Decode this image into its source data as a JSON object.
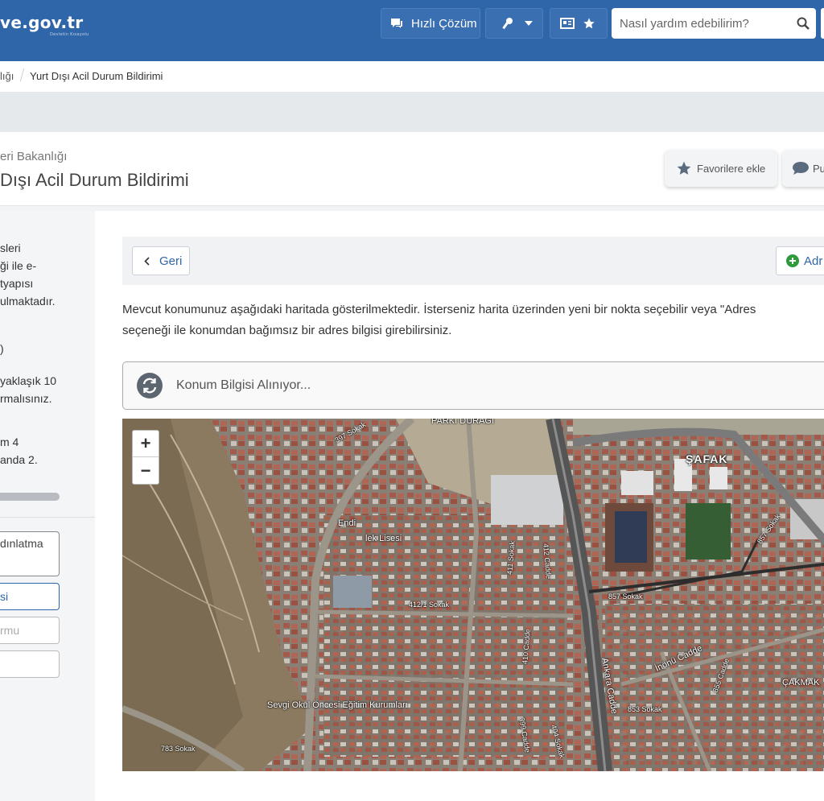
{
  "header": {
    "logo_text": "ve.gov.tr",
    "logo_tagline": "Devletin Kısayolu",
    "quick_solution_label": "Hızlı Çözüm",
    "search_placeholder": "Nasıl yardım edebilirim?",
    "colors": {
      "bar": "#2f66a9",
      "button": "#3a70b2"
    }
  },
  "breadcrumb": {
    "items": [
      "lığı",
      "Yurt Dışı Acil Durum Bildirimi"
    ]
  },
  "title_card": {
    "ministry": "eri Bakanlığı",
    "title": "Dışı Acil Durum Bildirimi",
    "favorite_label": "Favorilere ekle",
    "rate_label": "Pu"
  },
  "sidebar": {
    "p1": [
      "sleri",
      "ği ile e-",
      "tyapısı",
      "ulmaktadır."
    ],
    "p2": ")",
    "p2b": [
      "yaklaşık 10",
      "rmalısınız."
    ],
    "p3_lines": [
      "m 4",
      "anda 2."
    ],
    "steps": [
      {
        "label_lines": [
          "dınlatma",
          ""
        ]
      },
      {
        "label": "si"
      },
      {
        "label": "rmu"
      },
      {
        "label": ""
      }
    ],
    "progress_fraction": 0.5
  },
  "main": {
    "back_label": "Geri",
    "address_label": "Adr",
    "description_line1": "Mevcut konumunuz aşağıdaki haritada gösterilmektedir. İsterseniz harita üzerinden yeni bir nokta seçebilir veya \"Adres",
    "description_line2": "seçeneği ile konumdan bağımsız bir adres bilgisi girebilirsiniz.",
    "location_status": "Konum Bilgisi Alınıyor..."
  },
  "map": {
    "zoom_in": "+",
    "zoom_out": "−",
    "labels": {
      "parki_duragi": "PARKI DURAĞI",
      "safak": "ŞAFAK",
      "cakmak": "ÇAKMAK",
      "school": "Sevgi Okul Öncesi Eğitim Kurumları",
      "lisesi": "lek Lisesi",
      "endu": "Endi",
      "sokak_412_1": "412/1 Sokak",
      "sokak_857_a": "857 Sokak",
      "sokak_857_b": "857 Sokak",
      "sokak_853": "853 Sokak",
      "sokak_783": "783 Sokak",
      "cadde_412": "412 Cadde",
      "sokak_411": "411 Sokak",
      "cadde_410": "410 Cadde",
      "cadde_399": "399 Cadde",
      "sokak_404": "404 Sokak",
      "ankara_cadde": "Ankara Cadde",
      "inonu_cadde": "İnönü Cadde",
      "cadde_855": "855 Cadde",
      "sokak_397": "397 Sokak"
    }
  }
}
